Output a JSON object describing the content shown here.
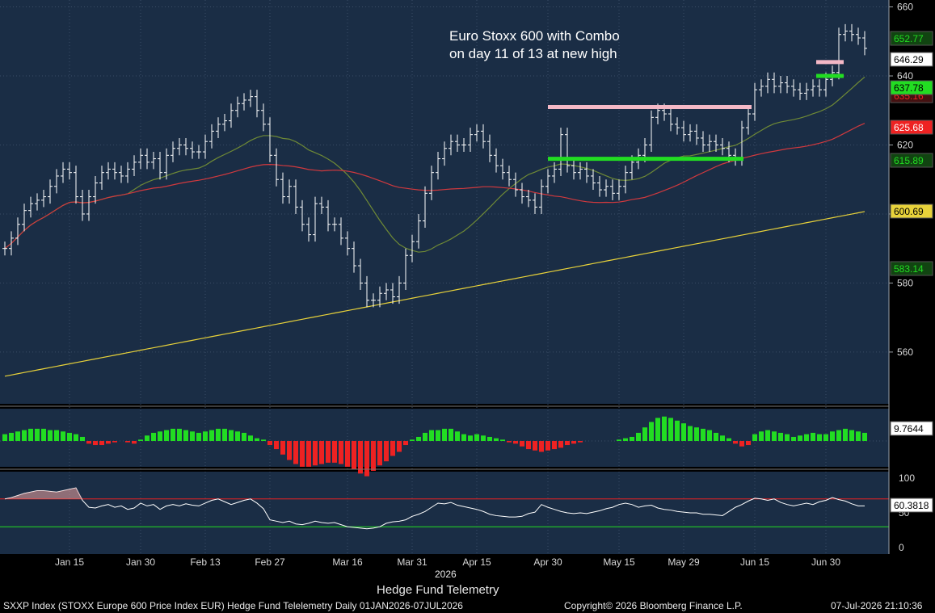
{
  "footer": {
    "left": "SXXP Index (STOXX Europe 600 Price Index EUR) Hedge Fund Telelemetry Daily 01JAN2026-07JUL2026",
    "center": "Copyright© 2026 Bloomberg Finance L.P.",
    "right": "07-Jul-2026 21:10:36",
    "source_label": "Hedge Fund Telemetry",
    "year_label": "2026"
  },
  "colors": {
    "background": "#1a2d45",
    "price_bar": "#ffffff",
    "sma_short": "#6f8a36",
    "sma_mid": "#d0393e",
    "sma_long": "#e8d23a",
    "buy": "#22dd22",
    "sell": "#ee2222",
    "magenta": "#cc33dd",
    "pink": "#f4b8c6",
    "rsi_line": "#ffffff"
  },
  "chart_data": [
    {
      "type": "line",
      "panel": "price",
      "title": "Euro Stoxx 600 with Combo",
      "subtitle": "on day 11 of 13 at new high",
      "ylim": [
        545,
        662
      ],
      "yticks": [
        560,
        580,
        600,
        620,
        640,
        660
      ],
      "xtick_labels": [
        "Jan 15",
        "Jan 30",
        "Feb 13",
        "Feb 27",
        "Mar 16",
        "Mar 31",
        "Apr 15",
        "Apr 30",
        "May 15",
        "May 29",
        "Jun 15",
        "Jun 30"
      ],
      "xtick_indices": [
        10,
        21,
        31,
        41,
        53,
        63,
        73,
        84,
        95,
        105,
        116,
        127
      ],
      "price_close": [
        590,
        593,
        597,
        601,
        603,
        604,
        605,
        608,
        611,
        613,
        612,
        605,
        600,
        605,
        609,
        612,
        613,
        612,
        611,
        613,
        615,
        617,
        615,
        616,
        612,
        617,
        619,
        620,
        619,
        618,
        618,
        621,
        624,
        626,
        627,
        630,
        632,
        633,
        634,
        630,
        626,
        617,
        610,
        605,
        608,
        602,
        597,
        594,
        603,
        602,
        597,
        597,
        593,
        590,
        585,
        580,
        575,
        575,
        577,
        578,
        576,
        580,
        588,
        592,
        598,
        606,
        612,
        616,
        619,
        621,
        620,
        620,
        623,
        624,
        621,
        617,
        614,
        612,
        610,
        607,
        605,
        604,
        602,
        608,
        611,
        613,
        623,
        614,
        612,
        613,
        611,
        609,
        607,
        608,
        606,
        608,
        612,
        615,
        617,
        620,
        628,
        630,
        629,
        626,
        625,
        623,
        624,
        622,
        620,
        621,
        620,
        619,
        617,
        616,
        625,
        629,
        636,
        637,
        639,
        637,
        638,
        637,
        636,
        635,
        636,
        637,
        636,
        639,
        641,
        652,
        653,
        652,
        651,
        648
      ],
      "volume_delta": [
        0.5,
        0.6,
        0.7,
        0.8,
        0.9,
        0.9,
        0.9,
        0.8,
        0.8,
        0.7,
        0.6,
        0.5,
        0.3,
        -0.2,
        -0.3,
        -0.3,
        -0.2,
        -0.1,
        0.0,
        -0.1,
        -0.2,
        0.1,
        0.4,
        0.6,
        0.7,
        0.8,
        0.9,
        0.9,
        0.8,
        0.7,
        0.6,
        0.7,
        0.8,
        0.9,
        0.9,
        0.8,
        0.7,
        0.6,
        0.4,
        0.2,
        0.1,
        -0.3,
        -0.6,
        -1.0,
        -1.4,
        -1.7,
        -1.9,
        -1.9,
        -1.8,
        -1.7,
        -1.6,
        -1.6,
        -1.7,
        -1.9,
        -2.1,
        -2.4,
        -2.6,
        -2.2,
        -1.8,
        -1.5,
        -1.1,
        -0.8,
        -0.3,
        0.1,
        0.3,
        0.6,
        0.8,
        0.8,
        0.9,
        0.9,
        0.7,
        0.5,
        0.4,
        0.5,
        0.4,
        0.3,
        0.2,
        0.1,
        -0.1,
        -0.2,
        -0.4,
        -0.6,
        -0.7,
        -0.8,
        -0.7,
        -0.6,
        -0.5,
        -0.3,
        -0.2,
        -0.1,
        0.0,
        0.0,
        0.0,
        0.0,
        0.0,
        0.1,
        0.2,
        0.3,
        0.6,
        1.0,
        1.4,
        1.7,
        1.8,
        1.7,
        1.5,
        1.3,
        1.1,
        1.0,
        0.9,
        0.8,
        0.6,
        0.4,
        0.2,
        -0.2,
        -0.4,
        -0.3,
        0.5,
        0.7,
        0.8,
        0.7,
        0.6,
        0.5,
        0.3,
        0.4,
        0.5,
        0.6,
        0.5,
        0.5,
        0.7,
        0.8,
        0.9,
        0.8,
        0.7,
        0.6
      ],
      "labels": {
        "last": "646.29",
        "sma_short": "637.78",
        "sma_mid": "625.68",
        "sma_long": "600.69",
        "green1": "652.77",
        "green2": "615.89",
        "green3": "583.14",
        "red1": "635.16"
      }
    },
    {
      "type": "bar",
      "panel": "momentum",
      "ylim": [
        -3,
        3
      ],
      "last_label": "9.7644",
      "yticks": [
        0
      ]
    },
    {
      "type": "line",
      "panel": "rsi",
      "ylim": [
        0,
        100
      ],
      "yticks": [
        0,
        50,
        100
      ],
      "overbought": 70,
      "oversold": 30,
      "last_label": "60.3818",
      "values": [
        70,
        72,
        75,
        78,
        80,
        82,
        82,
        81,
        80,
        82,
        84,
        86,
        68,
        58,
        57,
        60,
        62,
        58,
        60,
        55,
        57,
        64,
        60,
        62,
        55,
        60,
        62,
        60,
        63,
        61,
        60,
        64,
        68,
        70,
        66,
        62,
        65,
        68,
        70,
        64,
        56,
        40,
        38,
        36,
        38,
        34,
        33,
        35,
        38,
        36,
        35,
        36,
        33,
        30,
        29,
        28,
        27,
        28,
        30,
        35,
        37,
        38,
        40,
        45,
        48,
        52,
        58,
        64,
        63,
        65,
        61,
        59,
        57,
        55,
        52,
        48,
        46,
        45,
        44,
        44,
        45,
        49,
        51,
        62,
        58,
        55,
        52,
        50,
        49,
        50,
        49,
        51,
        53,
        56,
        58,
        62,
        64,
        62,
        58,
        60,
        61,
        57,
        55,
        54,
        52,
        51,
        50,
        50,
        48,
        48,
        47,
        46,
        52,
        58,
        62,
        67,
        71,
        70,
        68,
        70,
        65,
        62,
        60,
        62,
        64,
        62,
        66,
        68,
        72,
        69,
        67,
        63,
        60,
        60
      ]
    }
  ]
}
